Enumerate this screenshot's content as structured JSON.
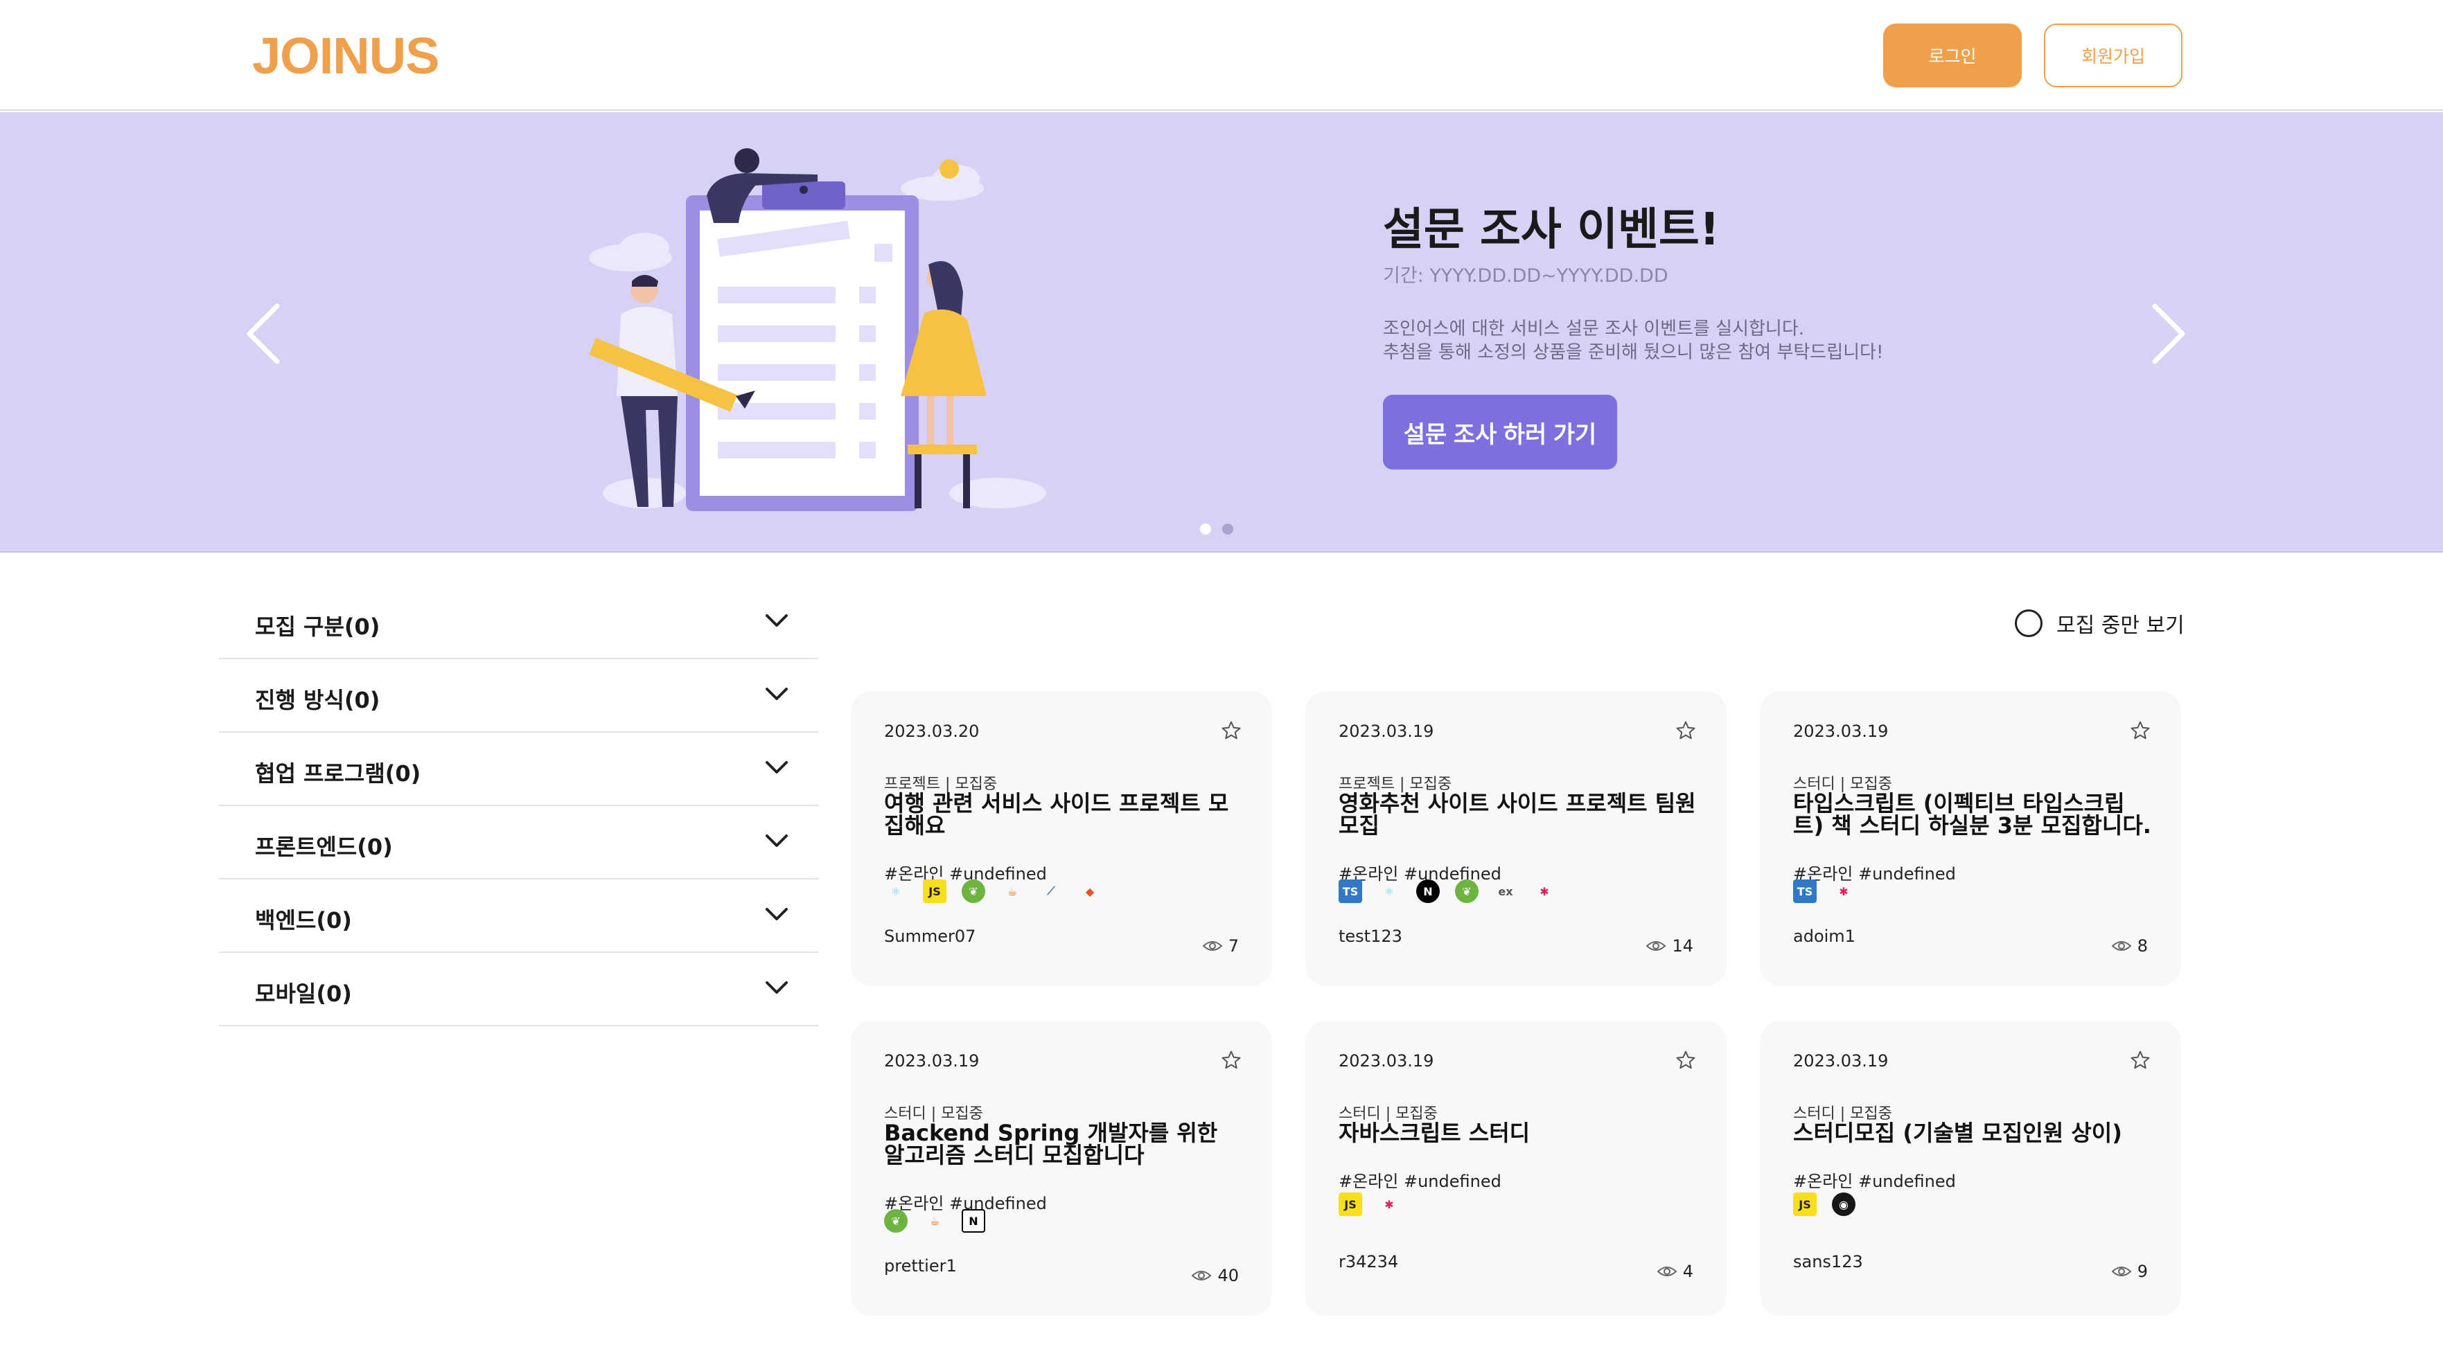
{
  "header": {
    "logo": "JOINUS",
    "login_label": "로그인",
    "signup_label": "회원가입"
  },
  "banner": {
    "title": "설문 조사 이벤트!",
    "period": "기간: YYYY.DD.DD~YYYY.DD.DD",
    "desc_line1": "조인어스에 대한 서비스 설문 조사 이벤트를 실시합니다.",
    "desc_line2": "추첨을 통해 소정의 상품을 준비해 뒀으니 많은 참여 부탁드립니다!",
    "cta_label": "설문 조사 하러 가기",
    "slide_count": 2,
    "active_slide": 1,
    "bg_color": "#d7d2f5",
    "cta_color": "#7c6fe0"
  },
  "filters": [
    {
      "label": "모집 구분(0)"
    },
    {
      "label": "진행 방식(0)"
    },
    {
      "label": "협업 프로그램(0)"
    },
    {
      "label": "프론트엔드(0)"
    },
    {
      "label": "백엔드(0)"
    },
    {
      "label": "모바일(0)"
    }
  ],
  "toggle": {
    "label": "모집 중만 보기",
    "checked": false
  },
  "cards": [
    {
      "date": "2023.03.20",
      "type": "프로젝트 | 모집중",
      "title": "여행 관련 서비스 사이드 프로젝트 모집해요",
      "tags": "#온라인 #undefined",
      "stack": [
        "react-icon",
        "javascript-icon",
        "spring-icon",
        "java-icon",
        "mysql-icon",
        "figma-icon"
      ],
      "author": "Summer07",
      "views": "7"
    },
    {
      "date": "2023.03.19",
      "type": "프로젝트 | 모집중",
      "title": "영화추천 사이트 사이드 프로젝트 팀원 모집",
      "tags": "#온라인 #undefined",
      "stack": [
        "typescript-icon",
        "react-icon",
        "nextjs-icon",
        "spring-icon",
        "express-icon",
        "slack-icon"
      ],
      "author": "test123",
      "views": "14"
    },
    {
      "date": "2023.03.19",
      "type": "스터디 | 모집중",
      "title": "타입스크립트 (이펙티브 타입스크립트) 책 스터디 하실분 3분 모집합니다.",
      "tags": "#온라인 #undefined",
      "stack": [
        "typescript-icon",
        "slack-icon"
      ],
      "author": "adoim1",
      "views": "8"
    },
    {
      "date": "2023.03.19",
      "type": "스터디 | 모집중",
      "title": "Backend Spring 개발자를 위한 알고리즘 스터디 모집합니다",
      "tags": "#온라인 #undefined",
      "stack": [
        "spring-icon",
        "java-icon",
        "notion-icon"
      ],
      "author": "prettier1",
      "views": "40"
    },
    {
      "date": "2023.03.19",
      "type": "스터디 | 모집중",
      "title": "자바스크립트 스터디",
      "tags": "#온라인 #undefined",
      "stack": [
        "javascript-icon",
        "slack-icon"
      ],
      "author": "r34234",
      "views": "4"
    },
    {
      "date": "2023.03.19",
      "type": "스터디 | 모집중",
      "title": "스터디모집 (기술별 모집인원 상이)",
      "tags": "#온라인 #undefined",
      "stack": [
        "javascript-icon",
        "github-icon"
      ],
      "author": "sans123",
      "views": "9"
    }
  ],
  "colors": {
    "brand": "#f0a04b",
    "card_bg": "#f7f8fa"
  }
}
